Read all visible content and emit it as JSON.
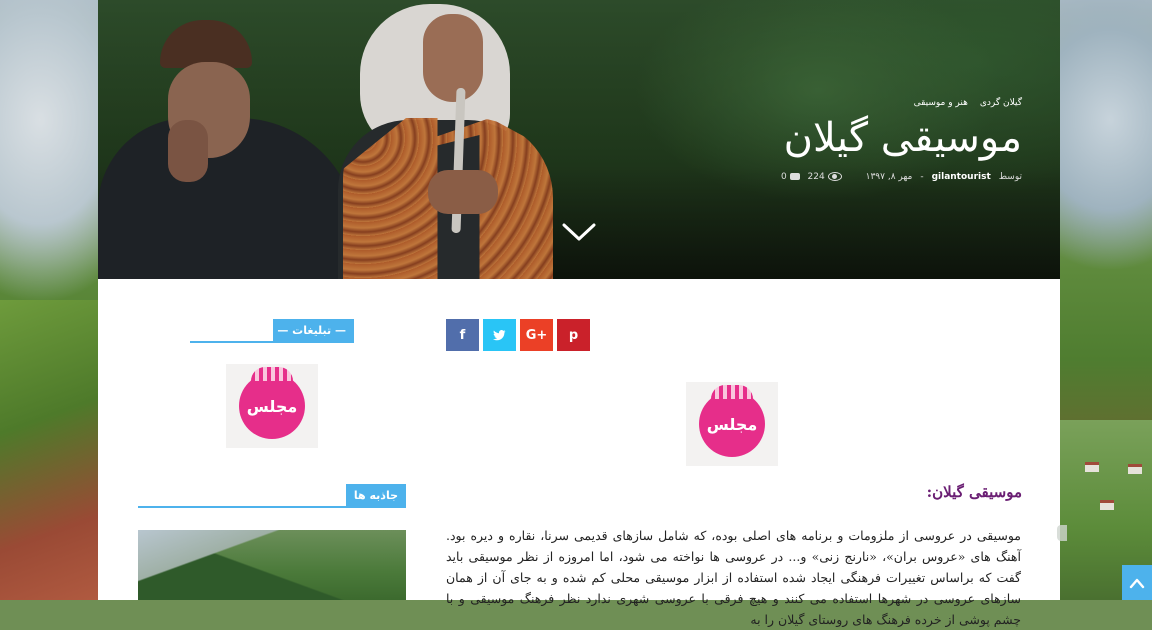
{
  "hero": {
    "categories": [
      "گیلان گردی",
      "هنر و موسیقی"
    ],
    "title": "موسیقی گیلان",
    "byline_prefix": "توسط",
    "author": "gilantourist",
    "separator": "-",
    "date": "مهر ۸, ۱۳۹۷",
    "views": "224",
    "comments": "0"
  },
  "share": {
    "facebook": "f",
    "twitter": "t",
    "gplus": "G+",
    "pinterest": "p"
  },
  "article": {
    "logo_text": "مجلس",
    "heading": "موسیقی گیلان:",
    "body": "موسیقی در عروسی از ملزومات و برنامه های اصلی بوده، که شامل سازهای قدیمی سرنا، نقاره و دیره بود. آهنگ های «عروس بران»، «نارنج زنی» و... در عروسی ها نواخته می شود، اما امروزه از نظر موسیقی باید گفت که براساس تغییرات فرهنگی ایجاد شده استفاده از ابزار موسیقی محلی کم شده و به جای آن از همان سازهای عروسی در شهرها استفاده می کنند و هیچ فرقی با عروسی شهری ندارد نظر فرهنگ موسیقی و با چشم پوشی از خرده فرهنگ های روستای گیلان را به"
  },
  "sidebar": {
    "ads_title": "— تبلیغات —",
    "ads_logo_text": "مجلس",
    "attractions_title": "جاذبه ها"
  },
  "icons": {
    "chevron": "chevron-down-icon",
    "eye": "eye-icon",
    "comment": "comment-icon",
    "scroll_top": "arrow-up-icon"
  },
  "colors": {
    "accent": "#4db2ec",
    "heading": "#6a1e73",
    "facebook": "#516eab",
    "twitter": "#29c5f6",
    "gplus": "#eb4026",
    "pinterest": "#ca212a",
    "logo_pink": "#e62e8a"
  }
}
